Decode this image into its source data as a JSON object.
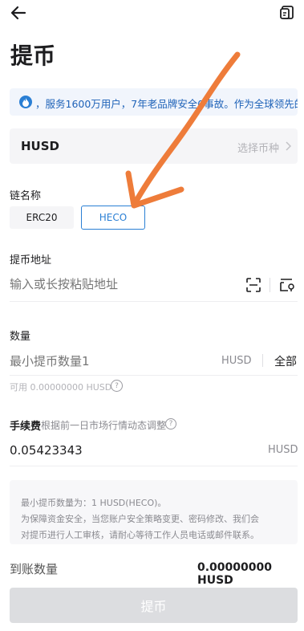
{
  "header": {
    "title": "提币"
  },
  "notice": {
    "text": "，服务1600万用户，7年老品牌安全0事故。作为全球领先的数"
  },
  "coin": {
    "symbol": "HUSD",
    "select_label": "选择币种"
  },
  "chain": {
    "label": "链名称",
    "options": [
      {
        "label": "ERC20",
        "selected": false
      },
      {
        "label": "HECO",
        "selected": true
      }
    ]
  },
  "address": {
    "label": "提币地址",
    "placeholder": "输入或长按粘贴地址"
  },
  "amount": {
    "label": "数量",
    "placeholder": "最小提币数量1",
    "unit": "HUSD",
    "all_label": "全部",
    "available": "可用 0.00000000 HUSD"
  },
  "fee": {
    "label": "手续费",
    "hint": "根据前一日市场行情动态调整",
    "value": "0.05423343",
    "unit": "HUSD"
  },
  "info": {
    "lines": [
      "最小提币数量为：1 HUSD(HECO)。",
      "为保障资金安全，当您账户安全策略变更、密码修改、我们会",
      "对提币进行人工审核，请耐心等待工作人员电话或邮件联系。"
    ]
  },
  "receive": {
    "label": "到账数量",
    "value": "0.00000000 HUSD"
  },
  "submit": {
    "label": "提币"
  },
  "colors": {
    "accent": "#2a7fd4",
    "annotation": "#ee7c3a",
    "disabled_button": "#dcdde0"
  }
}
